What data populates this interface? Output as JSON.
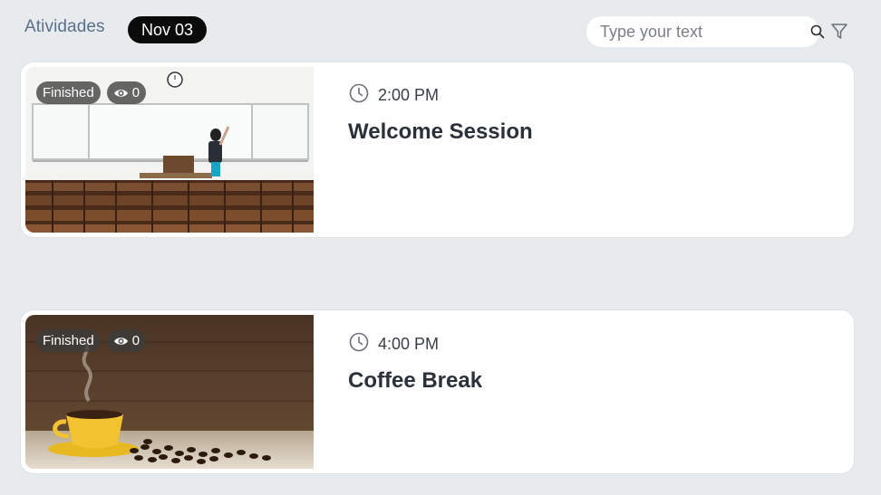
{
  "header": {
    "title": "Atividades",
    "date": "Nov 03"
  },
  "search": {
    "placeholder": "Type your text",
    "icon": "search-icon"
  },
  "filter": {
    "icon": "filter-icon"
  },
  "activities": [
    {
      "status": "Finished",
      "views": "0",
      "time": "2:00 PM",
      "title": "Welcome Session",
      "image": "lecture-hall-photo"
    },
    {
      "status": "Finished",
      "views": "0",
      "time": "4:00 PM",
      "title": "Coffee Break",
      "image": "coffee-cup-photo"
    }
  ],
  "colors": {
    "background": "#e8ebed",
    "title": "#5a6f8c",
    "pill": "#0b0b0b",
    "badge": "#3c3c3c"
  }
}
